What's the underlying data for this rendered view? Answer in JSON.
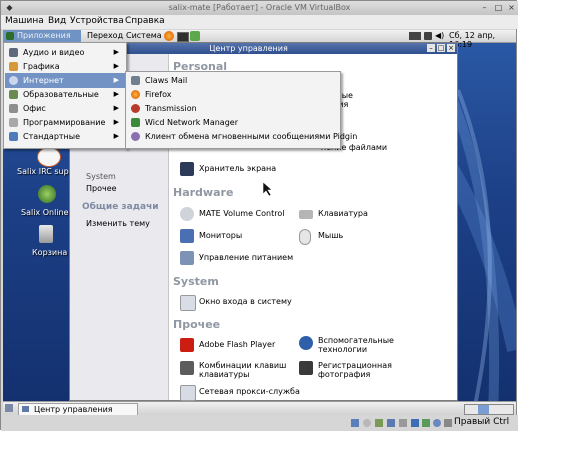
{
  "vbox": {
    "title": "salix-mate [Работает] - Oracle VM VirtualBox",
    "menu": [
      "Машина",
      "Вид",
      "Устройства",
      "Справка"
    ],
    "host_key": "Правый Ctrl"
  },
  "guest_panel": {
    "apps": "Приложения",
    "places": "Переход",
    "system": "Система",
    "clock": "Сб, 12 апр, 16:19"
  },
  "apps_menu": {
    "items": [
      {
        "label": "Аудио и видео"
      },
      {
        "label": "Графика"
      },
      {
        "label": "Интернет"
      },
      {
        "label": "Образовательные"
      },
      {
        "label": "Офис"
      },
      {
        "label": "Программирование"
      },
      {
        "label": "Стандартные"
      }
    ]
  },
  "internet_menu": {
    "items": [
      {
        "label": "Claws Mail"
      },
      {
        "label": "Firefox"
      },
      {
        "label": "Transmission"
      },
      {
        "label": "Wicd Network Manager"
      },
      {
        "label": "Клиент обмена мгновенными сообщениями Pidgin"
      }
    ]
  },
  "desktop": {
    "icons": [
      {
        "label": "Salix IRC supp"
      },
      {
        "label": "Salix Online"
      },
      {
        "label": "Корзина"
      }
    ]
  },
  "control_center": {
    "title": "Центр управления",
    "sidebar": {
      "partial_items": [
        "System",
        "Прочее"
      ],
      "tasks_header": "Общие задачи",
      "tasks": [
        "Изменить тему"
      ]
    },
    "main": {
      "sec_personal": "Personal",
      "partial_right_1": "каемые",
      "partial_right_2": "жения",
      "partial_right_3": "ление файлами",
      "screensaver": "Хранитель экрана",
      "sec_hardware": "Hardware",
      "mate_volume": "MATE Volume Control",
      "keyboard": "Клавиатура",
      "monitors": "Мониторы",
      "mouse": "Мышь",
      "power": "Управление питанием",
      "sec_system": "System",
      "login_window": "Окно входа в систему",
      "sec_other": "Прочее",
      "flash": "Adobe Flash Player",
      "assistive_1": "Вспомогательные",
      "assistive_2": "технологии",
      "shortcuts_1": "Комбинации клавиш",
      "shortcuts_2": "клавиатуры",
      "photo_1": "Регистрационная",
      "photo_2": "фотография",
      "proxy": "Сетевая прокси-служба"
    }
  },
  "taskbar": {
    "task": "Центр управления"
  },
  "colors": {
    "menu_highlight": "#7293c4",
    "titlebar": "#3e5f9c",
    "section_heading": "#8f97a3"
  }
}
